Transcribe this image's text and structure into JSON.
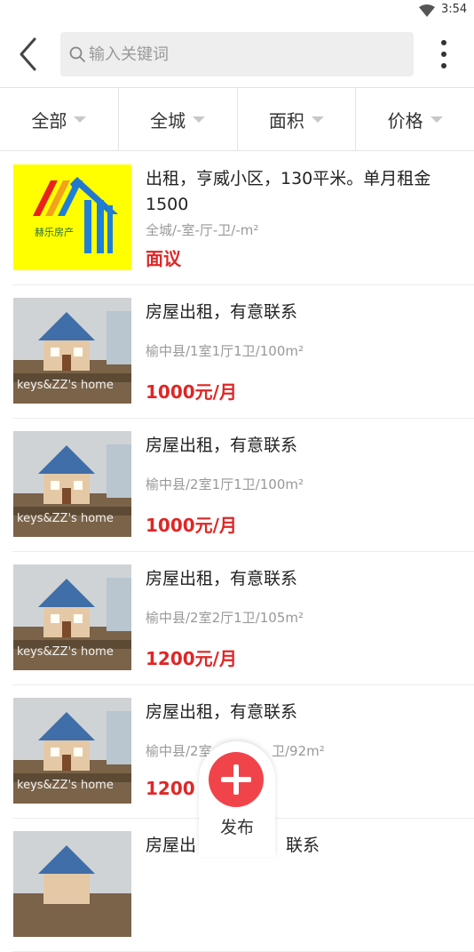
{
  "status_bar": {
    "time": "3:54"
  },
  "search": {
    "placeholder": "输入关键词"
  },
  "filters": [
    "全部",
    "全城",
    "面积",
    "价格"
  ],
  "listings": [
    {
      "title": "出租，亨威小区，130平米。单月租金1500",
      "meta": "全城/-室-厅-卫/-m²",
      "price": "面议",
      "image": "logo"
    },
    {
      "title": "房屋出租，有意联系",
      "meta": "榆中县/1室1厅1卫/100m²",
      "price": "1000元/月",
      "image": "house"
    },
    {
      "title": "房屋出租，有意联系",
      "meta": "榆中县/2室1厅1卫/100m²",
      "price": "1000元/月",
      "image": "house"
    },
    {
      "title": "房屋出租，有意联系",
      "meta": "榆中县/2室2厅1卫/105m²",
      "price": "1200元/月",
      "image": "house"
    },
    {
      "title": "房屋出租，有意联系",
      "meta": "榆中县/2室",
      "meta_tail": "卫/92m²",
      "price": "1200",
      "image": "house"
    },
    {
      "title": "房屋出",
      "title_tail": "联系",
      "meta": "",
      "price": "",
      "image": "house"
    }
  ],
  "logo_text": "赫乐房产",
  "photo_text": "keys&ZZ's home",
  "fab": {
    "label": "发布"
  },
  "colors": {
    "price_red": "#e02626",
    "fab_red": "#f0444a",
    "logo_yellow": "#ffff00"
  }
}
